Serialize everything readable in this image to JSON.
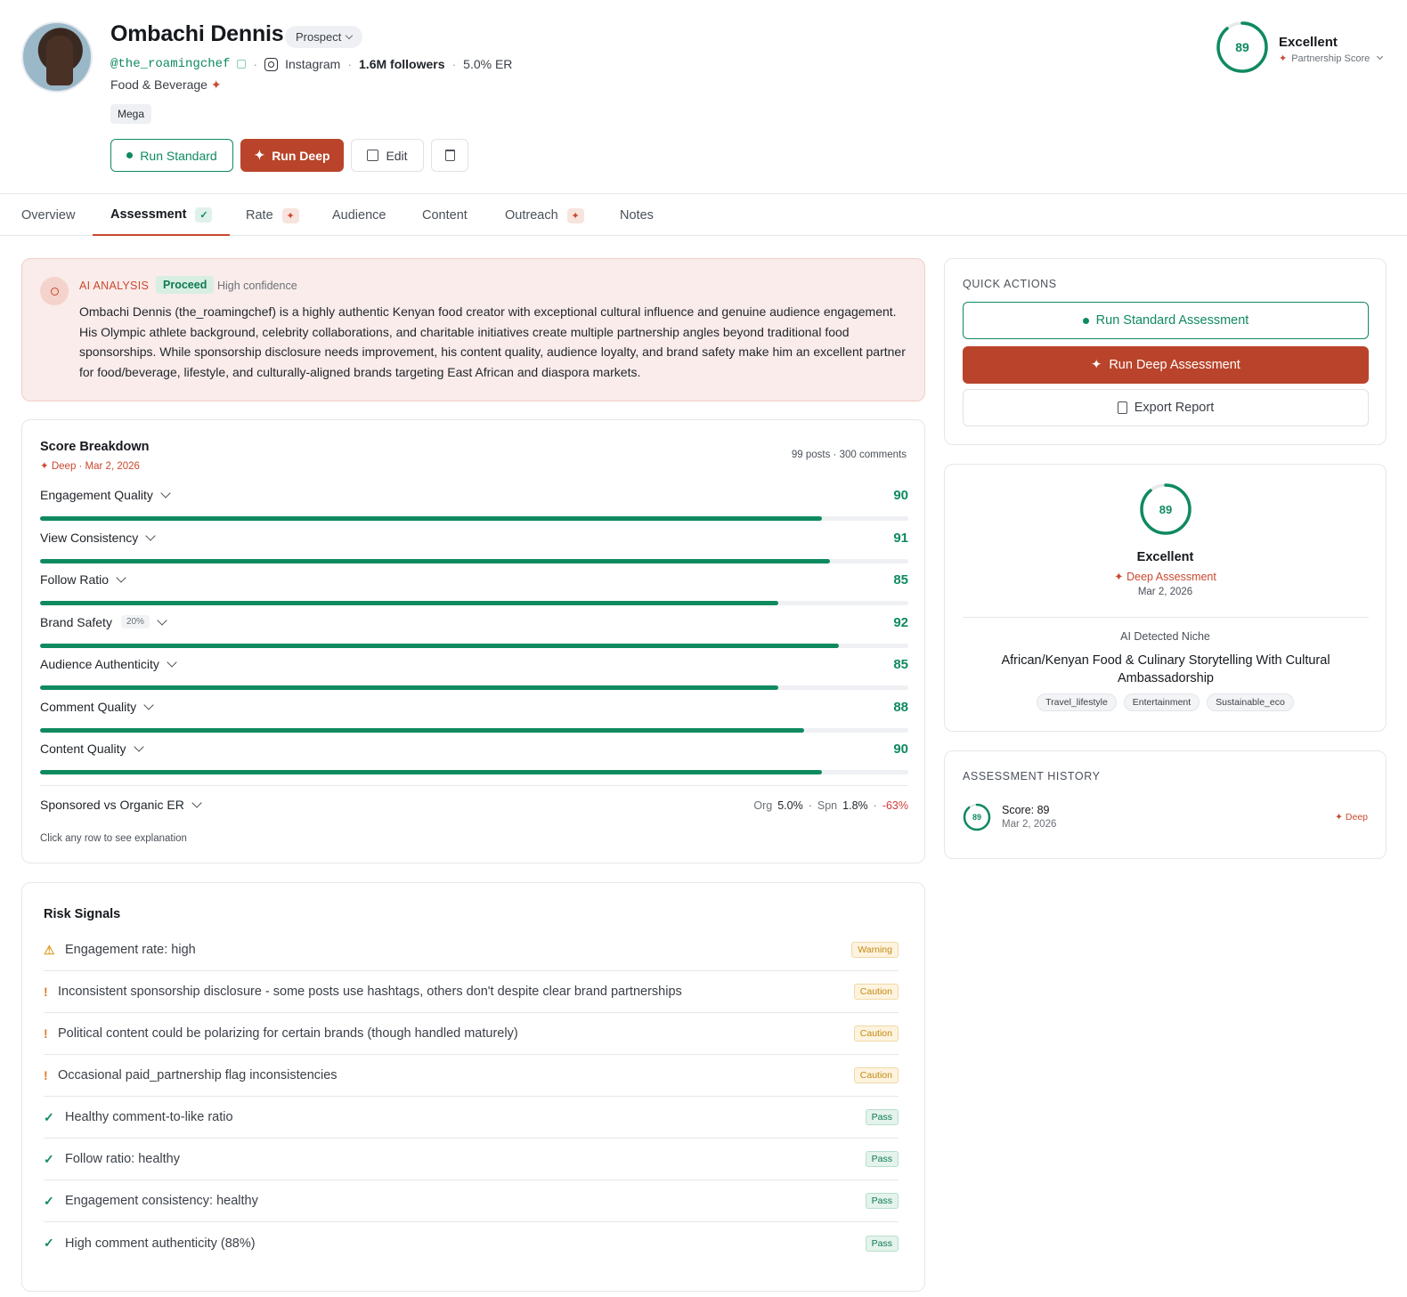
{
  "profile": {
    "name": "Ombachi Dennis",
    "status": "Prospect",
    "handle": "@the_roamingchef",
    "platform": "Instagram",
    "followers": "1.6M followers",
    "er": "5.0% ER",
    "category": "Food & Beverage",
    "tier": "Mega"
  },
  "actions": {
    "run_standard": "Run Standard",
    "run_deep": "Run Deep",
    "edit": "Edit"
  },
  "header_score": {
    "value": "89",
    "fraction": 0.89,
    "label": "Excellent",
    "sub": "Partnership Score"
  },
  "tabs": [
    {
      "label": "Overview"
    },
    {
      "label": "Assessment"
    },
    {
      "label": "Rate"
    },
    {
      "label": "Audience"
    },
    {
      "label": "Content"
    },
    {
      "label": "Outreach"
    },
    {
      "label": "Notes"
    }
  ],
  "ai": {
    "label": "AI ANALYSIS",
    "verdict": "Proceed",
    "confidence": "High confidence",
    "text": "Ombachi Dennis (the_roamingchef) is a highly authentic Kenyan food creator with exceptional cultural influence and genuine audience engagement. His Olympic athlete background, celebrity collaborations, and charitable initiatives create multiple partnership angles beyond traditional food sponsorships. While sponsorship disclosure needs improvement, his content quality, audience loyalty, and brand safety make him an excellent partner for food/beverage, lifestyle, and culturally-aligned brands targeting East African and diaspora markets."
  },
  "breakdown": {
    "title": "Score Breakdown",
    "sub": "Deep · Mar 2, 2026",
    "posts": "99 posts · 300 comments",
    "metrics": [
      {
        "name": "Engagement Quality",
        "value": 90
      },
      {
        "name": "View Consistency",
        "value": 91
      },
      {
        "name": "Follow Ratio",
        "value": 85
      },
      {
        "name": "Brand Safety",
        "value": 92,
        "weight": "20%"
      },
      {
        "name": "Audience Authenticity",
        "value": 85
      },
      {
        "name": "Comment Quality",
        "value": 88
      },
      {
        "name": "Content Quality",
        "value": 90
      }
    ],
    "sponsored": {
      "name": "Sponsored vs Organic ER",
      "org_label": "Org",
      "org": "5.0%",
      "spn_label": "Spn",
      "spn": "1.8%",
      "diff": "-63%"
    },
    "hint": "Click any row to see explanation"
  },
  "risk": {
    "title": "Risk Signals",
    "items": [
      {
        "text": "Engagement rate: high",
        "tag": "Warning",
        "kind": "warning",
        "icon": "warning-icon"
      },
      {
        "text": "Inconsistent sponsorship disclosure - some posts use hashtags, others don't despite clear brand partnerships",
        "tag": "Caution",
        "kind": "caution",
        "icon": "exclamation-icon"
      },
      {
        "text": "Political content could be polarizing for certain brands (though handled maturely)",
        "tag": "Caution",
        "kind": "caution",
        "icon": "exclamation-icon"
      },
      {
        "text": "Occasional paid_partnership flag inconsistencies",
        "tag": "Caution",
        "kind": "caution",
        "icon": "exclamation-icon"
      },
      {
        "text": "Healthy comment-to-like ratio",
        "tag": "Pass",
        "kind": "pass",
        "icon": "check-icon"
      },
      {
        "text": "Follow ratio: healthy",
        "tag": "Pass",
        "kind": "pass",
        "icon": "check-icon"
      },
      {
        "text": "Engagement consistency: healthy",
        "tag": "Pass",
        "kind": "pass",
        "icon": "check-icon"
      },
      {
        "text": "High comment authenticity (88%)",
        "tag": "Pass",
        "kind": "pass",
        "icon": "check-icon"
      }
    ]
  },
  "quick_actions": {
    "title": "QUICK ACTIONS",
    "standard": "Run Standard Assessment",
    "deep": "Run Deep Assessment",
    "export": "Export Report"
  },
  "summary": {
    "score": "89",
    "fraction": 0.89,
    "label": "Excellent",
    "type": "Deep Assessment",
    "date": "Mar 2, 2026",
    "niche_label": "AI Detected Niche",
    "niche": "African/Kenyan Food & Culinary Storytelling With Cultural Ambassadorship",
    "tags": [
      "Travel_lifestyle",
      "Entertainment",
      "Sustainable_eco"
    ]
  },
  "history": {
    "title": "ASSESSMENT HISTORY",
    "score_badge": "89",
    "fraction": 0.89,
    "score": "Score: 89",
    "date": "Mar 2, 2026",
    "type": "Deep"
  },
  "colors": {
    "accent": "#0f8a5f",
    "brand": "#b9442b",
    "danger": "#d33a3a"
  }
}
